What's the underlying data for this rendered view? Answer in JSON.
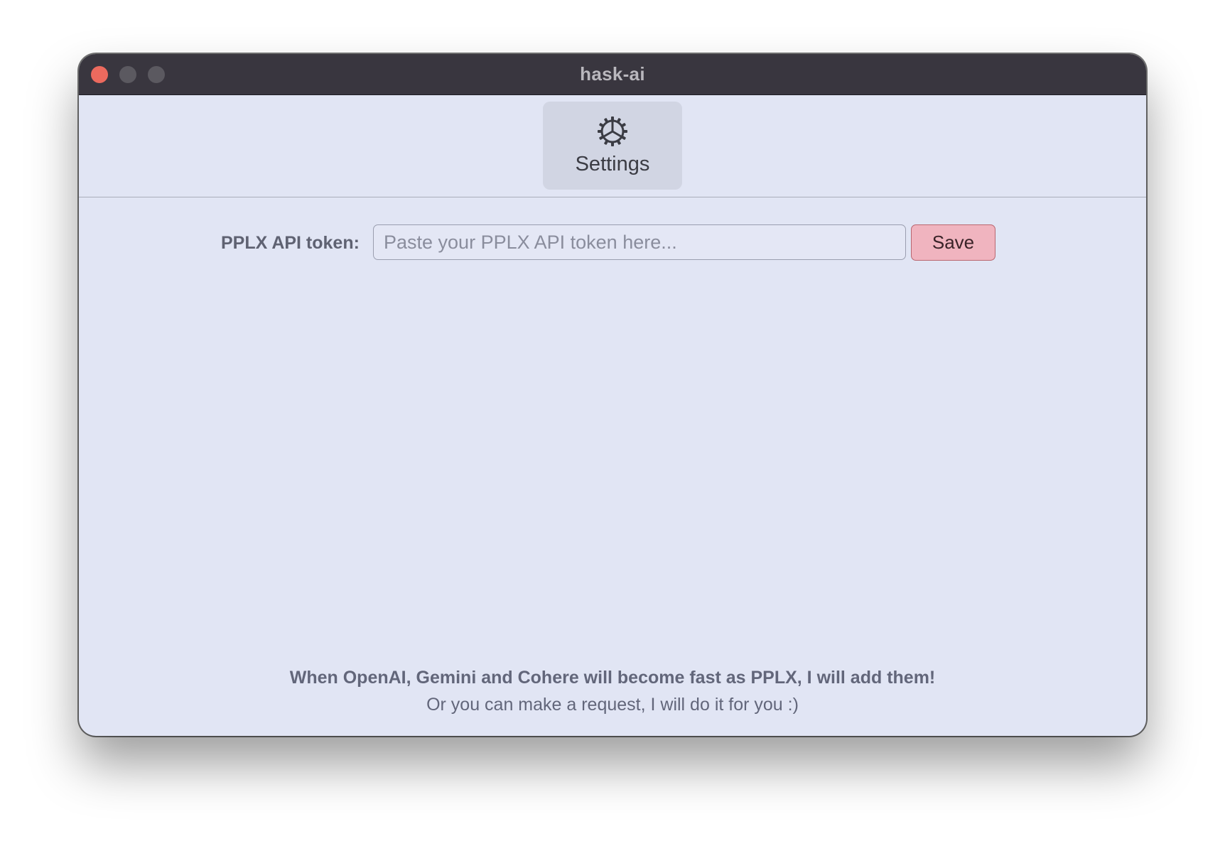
{
  "window": {
    "title": "hask-ai"
  },
  "toolbar": {
    "settings_tab": {
      "label": "Settings",
      "icon": "gear-icon"
    }
  },
  "settings": {
    "token_label": "PPLX API token:",
    "token_value": "",
    "token_placeholder": "Paste your PPLX API token here...",
    "save_label": "Save"
  },
  "footer": {
    "line1": "When OpenAI, Gemini and Cohere will become fast as PPLX, I will add them!",
    "line2": "Or you can make a request, I will do it for you :)"
  },
  "colors": {
    "titlebar": "#39363f",
    "content_bg": "#e1e5f4",
    "close": "#ec6a5e",
    "save_bg": "#f0b4bf"
  }
}
